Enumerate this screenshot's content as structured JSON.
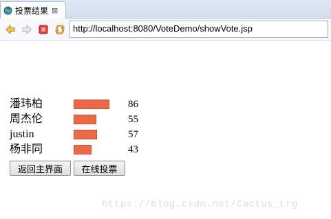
{
  "tab": {
    "title": "投票结果",
    "close_glyph": "⊠"
  },
  "toolbar": {
    "back_icon": "back-arrow-icon",
    "forward_icon": "forward-arrow-icon",
    "stop_icon": "stop-icon",
    "refresh_icon": "refresh-icon",
    "url": "http://localhost:8080/VoteDemo/showVote.jsp"
  },
  "chart_data": {
    "type": "bar",
    "orientation": "horizontal",
    "categories": [
      "潘玮柏",
      "周杰伦",
      "justin",
      "杨非同"
    ],
    "values": [
      86,
      55,
      57,
      43
    ],
    "title": "",
    "xlabel": "",
    "ylabel": "",
    "bar_color": "#ee6845"
  },
  "buttons": {
    "back_main": "返回主界面",
    "vote_online": "在线投票"
  },
  "watermark": "https://blog.csdn.net/Cactus_Lrg"
}
